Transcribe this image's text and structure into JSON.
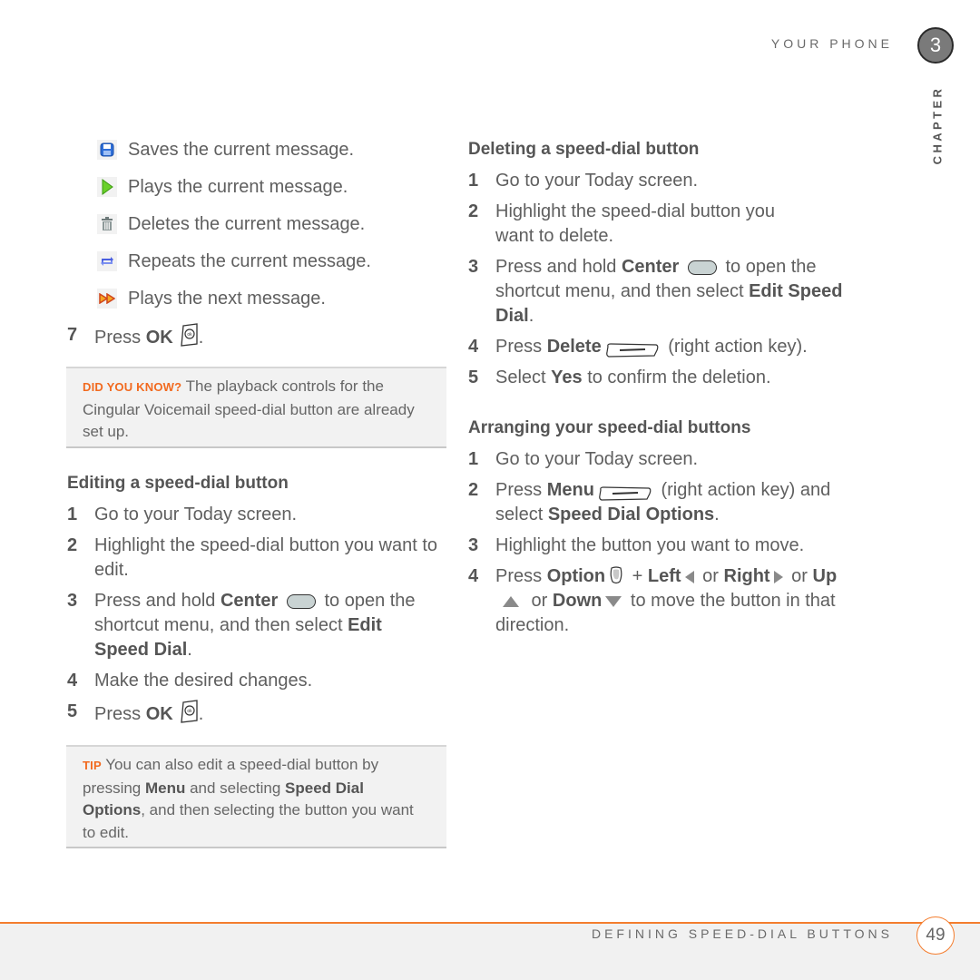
{
  "header": {
    "running_head": "YOUR PHONE",
    "chapter_number": "3",
    "chapter_label": "CHAPTER"
  },
  "left_column": {
    "icon_items": [
      {
        "icon": "save-icon",
        "text": "Saves the current message."
      },
      {
        "icon": "play-icon",
        "text": "Plays the current message."
      },
      {
        "icon": "trash-icon",
        "text": "Deletes the current message."
      },
      {
        "icon": "repeat-icon",
        "text": "Repeats the current message."
      },
      {
        "icon": "next-icon",
        "text": "Plays the next message."
      }
    ],
    "step7": {
      "num": "7",
      "pre": "Press ",
      "bold": "OK",
      "post": "."
    },
    "did_you_know": {
      "label": "DID YOU KNOW?",
      "text": "The playback controls for the Cingular Voicemail speed-dial button are already set up."
    },
    "editing": {
      "heading": "Editing a speed-dial button",
      "steps": [
        {
          "num": "1",
          "text": "Go to your Today screen."
        },
        {
          "num": "2",
          "text": "Highlight the speed-dial button you want to edit."
        },
        {
          "num": "3",
          "pre": "Press and hold ",
          "bold1": "Center",
          "mid": " to open the shortcut menu, and then select ",
          "bold2": "Edit Speed Dial",
          "post": "."
        },
        {
          "num": "4",
          "text": "Make the desired changes."
        },
        {
          "num": "5",
          "pre": "Press ",
          "bold": "OK",
          "post": "."
        }
      ]
    },
    "tip": {
      "label": "TIP",
      "t1": "You can also edit a speed-dial button by pressing ",
      "b1": "Menu",
      "t2": " and selecting ",
      "b2": "Speed Dial Options",
      "t3": ", and then selecting the button you want to edit."
    }
  },
  "right_column": {
    "deleting": {
      "heading": "Deleting a speed-dial button",
      "steps": [
        {
          "num": "1",
          "text": "Go to your Today screen."
        },
        {
          "num": "2",
          "text": "Highlight the speed-dial button you want to delete."
        },
        {
          "num": "3",
          "pre": "Press and hold ",
          "bold1": "Center",
          "mid": " to open the shortcut menu, and then select ",
          "bold2": "Edit Speed Dial",
          "post": "."
        },
        {
          "num": "4",
          "pre": "Press ",
          "bold": "Delete",
          "post": " (right action key)."
        },
        {
          "num": "5",
          "pre": "Select ",
          "bold": "Yes",
          "post": " to confirm the deletion."
        }
      ]
    },
    "arranging": {
      "heading": "Arranging your speed-dial buttons",
      "steps": [
        {
          "num": "1",
          "text": "Go to your Today screen."
        },
        {
          "num": "2",
          "pre": "Press ",
          "bold1": "Menu",
          "mid": " (right action key) and select ",
          "bold2": "Speed Dial Options",
          "post": "."
        },
        {
          "num": "3",
          "text": "Highlight the button you want to move."
        },
        {
          "num": "4",
          "pre": "Press ",
          "b_option": "Option",
          "plus": " + ",
          "b_left": "Left",
          "or1": " or ",
          "b_right": "Right",
          "or2": " or ",
          "b_up": "Up",
          "or3": " or ",
          "b_down": "Down",
          "post": " to move the button in that direction."
        }
      ]
    }
  },
  "footer": {
    "section_title": "DEFINING SPEED-DIAL BUTTONS",
    "page_number": "49"
  },
  "colors": {
    "accent_orange": "#f47d2e",
    "note_label_orange": "#f26a1f",
    "note_background": "#f2f2f2",
    "chapter_badge": "#7a7a7a"
  }
}
